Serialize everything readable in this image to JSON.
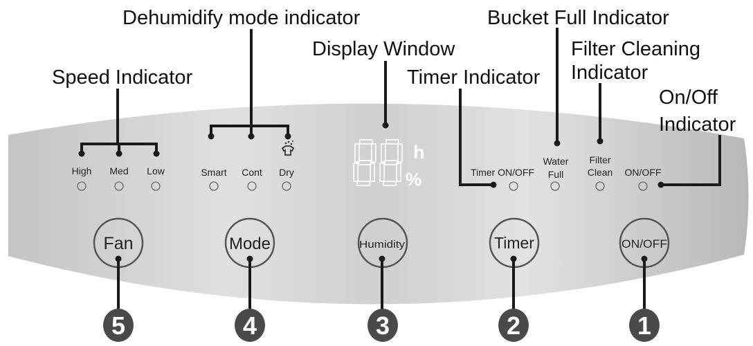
{
  "callouts": {
    "speed": "Speed Indicator",
    "dehumidify": "Dehumidify mode indicator",
    "display": "Display Window",
    "timer": "Timer Indicator",
    "bucket": "Bucket Full Indicator",
    "filter_line1": "Filter Cleaning",
    "filter_line2": "Indicator",
    "onoff_line1": "On/Off",
    "onoff_line2": "Indicator"
  },
  "speed_leds": [
    "High",
    "Med",
    "Low"
  ],
  "mode_leds": [
    "Smart",
    "Cont",
    "Dry"
  ],
  "status_leds": {
    "timer": "Timer ON/OFF",
    "water_line1": "Water",
    "water_line2": "Full",
    "filter_line1": "Filter",
    "filter_line2": "Clean",
    "power": "ON/OFF"
  },
  "display": {
    "value": "88",
    "unit_hours": "h",
    "unit_percent": "%"
  },
  "buttons": [
    {
      "label": "Fan",
      "number": "5"
    },
    {
      "label": "Mode",
      "number": "4"
    },
    {
      "label": "Humidity",
      "number": "3"
    },
    {
      "label": "Timer",
      "number": "2"
    },
    {
      "label": "ON/OFF",
      "number": "1"
    }
  ],
  "icons": {
    "dry": "shirt-drying-icon"
  },
  "colors": {
    "panel_light": "#e2e2e2",
    "panel_dark": "#bdbdbd",
    "number_badge": "#4a4a4a",
    "display_segments": "#ffffff"
  }
}
